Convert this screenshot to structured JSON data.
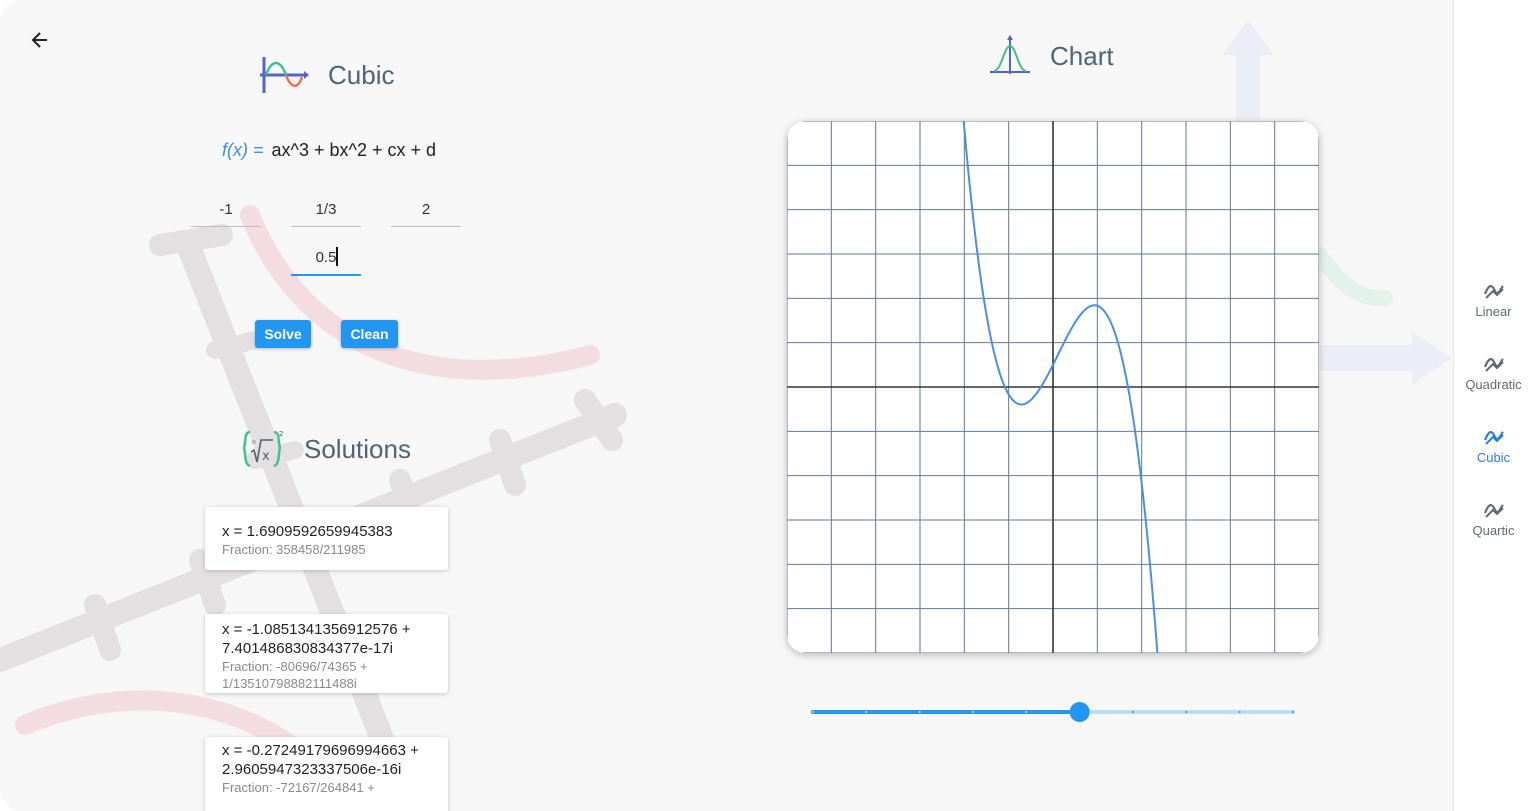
{
  "left_panel": {
    "title": "Cubic",
    "formula_prefix": "f(x) =",
    "formula": "ax^3 + bx^2 + cx + d",
    "coefficients": {
      "a": "-1",
      "b": "1/3",
      "c": "2",
      "d": "0.5"
    },
    "solve_label": "Solve",
    "clean_label": "Clean",
    "solutions_title": "Solutions",
    "solutions": [
      {
        "x": "x = 1.6909592659945383",
        "fraction": "Fraction: 358458/211985"
      },
      {
        "x": "x = -1.0851341356912576 + 7.401486830834377e-17i",
        "fraction": "Fraction: -80696/74365 + 1/13510798882111488i"
      },
      {
        "x": "x = -0.27249179696994663 + 2.9605947323337506e-16i",
        "fraction": "Fraction: -72167/264841 +"
      }
    ]
  },
  "right_panel": {
    "title": "Chart",
    "slider": {
      "value": 5,
      "min": 0,
      "max": 9,
      "steps": 9
    }
  },
  "chart_data": {
    "type": "line",
    "title": "",
    "xlabel": "",
    "ylabel": "",
    "function": "y = -x^3 + (1/3)x^2 + 2x + 0.5",
    "xlim": [
      -6,
      6
    ],
    "ylim": [
      -6,
      6
    ],
    "grid": true,
    "series": [
      {
        "points": [
          [
            -2.0,
            6.33
          ],
          [
            -1.5,
            2.63
          ],
          [
            -1.0,
            -0.17
          ],
          [
            -0.75,
            -0.45
          ],
          [
            -0.5,
            -0.29
          ],
          [
            0.0,
            0.5
          ],
          [
            0.5,
            1.46
          ],
          [
            1.0,
            1.83
          ],
          [
            1.25,
            1.68
          ],
          [
            1.5,
            1.38
          ],
          [
            2.0,
            -0.17
          ],
          [
            2.5,
            -6.0
          ]
        ]
      }
    ]
  },
  "colors": {
    "accent": "#2196f3",
    "curve": "#4a8ee8",
    "grid": "#5f7a92",
    "title_text": "#4f6475"
  },
  "nav": {
    "items": [
      {
        "label": "Linear",
        "icon": "chart-line-icon",
        "active": false
      },
      {
        "label": "Quadratic",
        "icon": "chart-line-icon",
        "active": false
      },
      {
        "label": "Cubic",
        "icon": "chart-line-icon",
        "active": true
      },
      {
        "label": "Quartic",
        "icon": "chart-line-icon",
        "active": false
      }
    ]
  }
}
